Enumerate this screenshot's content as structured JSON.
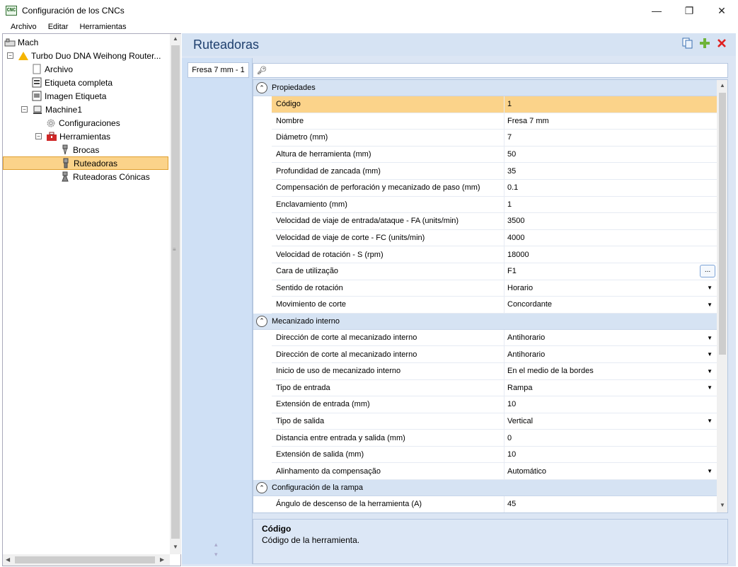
{
  "window": {
    "app_icon": "CNC",
    "title": "Configuración de los CNCs",
    "minimize": "—",
    "restore": "❐",
    "close": "✕"
  },
  "menu": [
    "Archivo",
    "Editar",
    "Herramientas"
  ],
  "tree": {
    "items": [
      {
        "label": "Mach",
        "icon": "machine-icon",
        "indent": 0
      },
      {
        "label": "Turbo Duo DNA Weihong Router...",
        "icon": "warning-icon",
        "indent": 1,
        "expander": "⊟"
      },
      {
        "label": "Archivo",
        "icon": "file-icon",
        "indent": 2
      },
      {
        "label": "Etiqueta completa",
        "icon": "label-icon",
        "indent": 2
      },
      {
        "label": "Imagen Etiqueta",
        "icon": "image-label-icon",
        "indent": 2
      },
      {
        "label": "Machine1",
        "icon": "machine-small-icon",
        "indent": 2,
        "expander": "⊟"
      },
      {
        "label": "Configuraciones",
        "icon": "gear-icon",
        "indent": 3
      },
      {
        "label": "Herramientas",
        "icon": "toolbox-icon",
        "indent": 3,
        "expander": "⊟"
      },
      {
        "label": "Brocas",
        "icon": "drill-icon",
        "indent": 4
      },
      {
        "label": "Ruteadoras",
        "icon": "router-bit-icon",
        "indent": 4,
        "selected": true
      },
      {
        "label": "Ruteadoras Cónicas",
        "icon": "conical-bit-icon",
        "indent": 4
      }
    ]
  },
  "panel": {
    "title": "Ruteadoras",
    "tab": "Fresa 7 mm - 1",
    "search_placeholder": ""
  },
  "grid": {
    "categories": [
      {
        "name": "Propiedades",
        "rows": [
          {
            "name": "Código",
            "value": "1",
            "selected": true
          },
          {
            "name": "Nombre",
            "value": "Fresa 7 mm"
          },
          {
            "name": "Diámetro (mm)",
            "value": "7"
          },
          {
            "name": "Altura de herramienta (mm)",
            "value": "50"
          },
          {
            "name": "Profundidad de zancada (mm)",
            "value": "35"
          },
          {
            "name": "Compensación de perforación y mecanizado de paso (mm)",
            "value": "0.1"
          },
          {
            "name": "Enclavamiento (mm)",
            "value": "1"
          },
          {
            "name": "Velocidad de viaje de entrada/ataque - FA (units/min)",
            "value": "3500"
          },
          {
            "name": "Velocidad de viaje de corte - FC (units/min)",
            "value": "4000"
          },
          {
            "name": "Velocidad de rotación - S (rpm)",
            "value": "18000"
          },
          {
            "name": "Cara de utilização",
            "value": "F1",
            "editor": "ellipsis"
          },
          {
            "name": "Sentido de rotación",
            "value": "Horario",
            "editor": "dropdown"
          },
          {
            "name": "Movimiento de corte",
            "value": "Concordante",
            "editor": "dropdown"
          }
        ]
      },
      {
        "name": "Mecanizado interno",
        "rows": [
          {
            "name": "Dirección de corte al mecanizado interno",
            "value": "Antihorario",
            "editor": "dropdown"
          },
          {
            "name": "Dirección de corte al mecanizado interno",
            "value": "Antihorario",
            "editor": "dropdown"
          },
          {
            "name": "Inicio de uso de mecanizado interno",
            "value": "En el medio de la bordes",
            "editor": "dropdown"
          },
          {
            "name": "Tipo de entrada",
            "value": "Rampa",
            "editor": "dropdown"
          },
          {
            "name": "Extensión de entrada (mm)",
            "value": "10"
          },
          {
            "name": "Tipo de salida",
            "value": "Vertical",
            "editor": "dropdown"
          },
          {
            "name": "Distancia entre entrada y salida (mm)",
            "value": "0"
          },
          {
            "name": "Extensión de salida (mm)",
            "value": "10"
          },
          {
            "name": "Alinhamento da compensação",
            "value": "Automático",
            "editor": "dropdown"
          }
        ]
      },
      {
        "name": "Configuración de la rampa",
        "rows": [
          {
            "name": "Ángulo de descenso de la herramienta (A)",
            "value": "45"
          }
        ]
      }
    ]
  },
  "description": {
    "title": "Código",
    "text": "Código de la herramienta."
  },
  "colors": {
    "selection": "#fbd38a",
    "panel_bg": "#dce6f4",
    "header_text": "#1e3f6e"
  }
}
